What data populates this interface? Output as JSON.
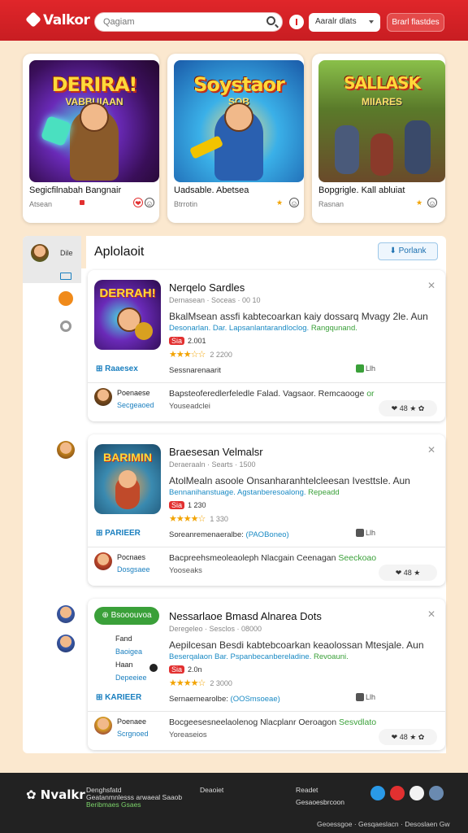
{
  "header": {
    "logo": "Valkor",
    "search_placeholder": "Qagiam",
    "select_label": "Aaralr dlats",
    "button_label": "Brarl flastdes"
  },
  "featured": [
    {
      "art_title": "DERIRA!",
      "art_sub": "VABBUIAAN",
      "title": "Segicfilnabah Bangnair",
      "dev": "Atsean",
      "icon": "★"
    },
    {
      "art_title": "Soystaor",
      "art_sub": "SOB",
      "title": "Uadsable. Abetsea",
      "dev": "Btrrotin",
      "icon": "★"
    },
    {
      "art_title": "SALLASK",
      "art_sub": "MIIARES",
      "title": "Bopgrigle. Kall abluiat",
      "dev": "Rasnan",
      "icon": "★"
    }
  ],
  "sidebar": {
    "label": "Dile"
  },
  "main": {
    "title": "Aplolaoit",
    "download_label": "Porlank"
  },
  "entries": [
    {
      "thumb_title": "DERRAH!",
      "title": "Nerqelo Sardles",
      "meta": "Dernasean  ·  Soceas  ·  00 10",
      "desc": "BkalMsean assfi kabtecoarkan kaiy dossarq Mvagy 2le. Aun",
      "tags": "Desonarlan. Dar. Lapsanlantarandloclog.",
      "tags_green": "Rangqunand.",
      "price": "2.001",
      "badge": "Sia",
      "stars": "★★★☆☆",
      "count": "2 2200",
      "link": "Raaesex",
      "comment": "Sessnarenaarit",
      "comment_blue": "",
      "right_count": "Llh",
      "user": "Poenaese",
      "user2": "Secgeaoed",
      "utext": "Bapsteoferedlerfeledle Falad. Vagsaor. Remcaooge",
      "utext_green": "or",
      "usub": "Youseadclei",
      "react": "❤ 48 ★ ✿"
    },
    {
      "thumb_title": "BARIMIN",
      "title": "Braesesan Velmalsr",
      "meta": "Deraeraaln  ·  Searts  ·  1500",
      "desc": "AtolMealn asoole Onsanharanhtelcleesan Ivesttsle. Aun",
      "tags": "Bennanihanstuage. Agstanberesoalong.",
      "tags_green": "Repeadd",
      "price": "1 230",
      "badge": "Sia",
      "stars": "★★★★☆",
      "count": "1 330",
      "link": "PARIEER",
      "comment": "Soreanremenaeralbe:",
      "comment_blue": "(PAOBoneo)",
      "right_count": "Llh",
      "user": "Pocnaes",
      "user2": "Dosgsaee",
      "utext": "Bacpreehsmeoleaoleph Nlacgain Ceenagan",
      "utext_green": "Seeckoao",
      "usub": "Yooseaks",
      "react": "❤ 48 ★"
    },
    {
      "thumb_title": "",
      "pill": "Bsooouvoa",
      "plain_lines": [
        "Fand",
        "Baoigea",
        "Haan",
        "Depeeiee"
      ],
      "title": "Nessarlaoe Bmasd Alnarea Dots",
      "meta": "Deregeleo  ·  Sesclos  ·  08000",
      "desc": "Aepilcesan Besdi kabtebcoarkan keaolossan Mtesjale. Aun",
      "tags": "Beserqalaon Bar. Pspanbecanbereladine.",
      "tags_green": "Revoauni.",
      "price": "2.0n",
      "badge": "Sia",
      "stars": "★★★★☆",
      "count": "2 3000",
      "link": "KARIEER",
      "comment": "Sernaemearolbe:",
      "comment_blue": "(OOSmsoeae)",
      "right_count": "Llh",
      "user": "Poenaee",
      "user2": "Scrgnoed",
      "utext": "Bocgeesesneelaolenog Nlacplanr Oeroagon",
      "utext_green": "Sesvdlato",
      "usub": "Yoreaseios",
      "react": "❤ 48 ★ ✿"
    }
  ],
  "footer": {
    "logo": "Nvalkr",
    "col1_a": "Denghsfatd",
    "col1_b": "Geatanmnlesss arwaeal Saaob",
    "col1_c": "Beribmaes Gsaes",
    "col2": "Deaoiet",
    "col3_a": "Readet",
    "col3_b": "Gesaoesbrcoon",
    "bottom": "Geoessgoe   ·   Gesqaeslacn   ·   Desoslaen Gw"
  },
  "colors": {
    "brand": "#d4222a",
    "accent_blue": "#1a7fbf",
    "accent_green": "#3aa039",
    "star": "#f2a300"
  }
}
